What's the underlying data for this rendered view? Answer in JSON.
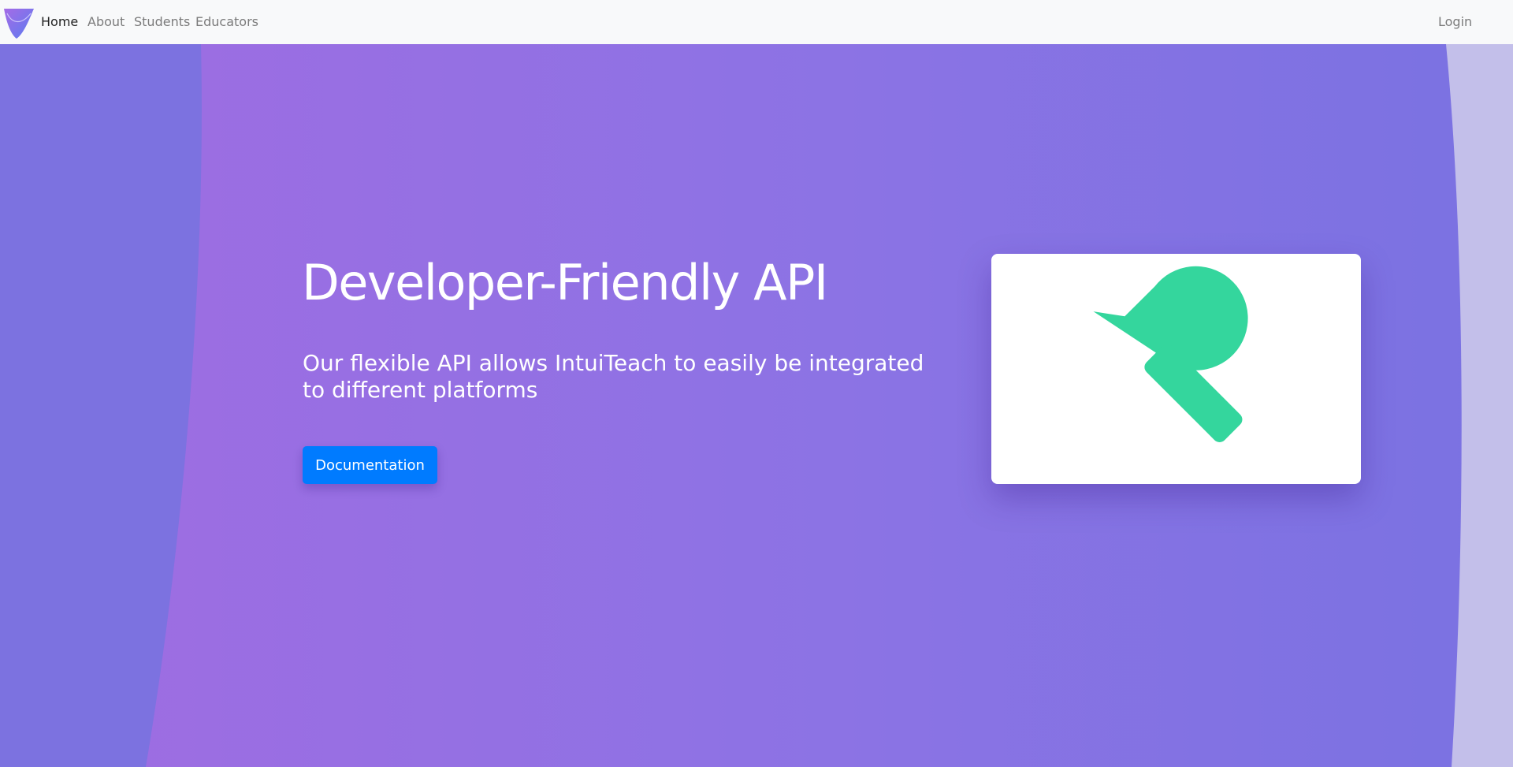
{
  "navbar": {
    "logo_icon": "intuiteach-logo-icon",
    "links": [
      {
        "label": "Home",
        "active": true
      },
      {
        "label": "About",
        "active": false
      },
      {
        "label": "Students",
        "active": false
      },
      {
        "label": "Educators",
        "active": false
      }
    ],
    "login_label": "Login"
  },
  "hero": {
    "title": "Developer-Friendly API",
    "subtitle": "Our flexible API allows IntuiTeach to easily be integrated to different platforms",
    "button_label": "Documentation",
    "card_icon": "wrench-icon"
  },
  "colors": {
    "navbar_bg": "#f8f9fa",
    "hero_gradient_start": "#a06ce2",
    "hero_gradient_end": "#7a72e2",
    "button_bg": "#007bff",
    "wrench": "#34d69d"
  }
}
